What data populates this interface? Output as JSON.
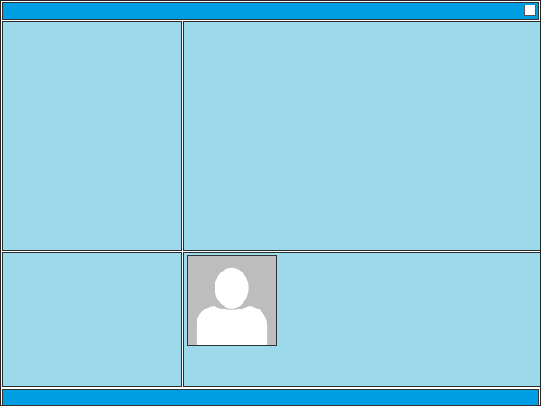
{
  "colors": {
    "titlebar": "#009fe3",
    "statusbar": "#009fe3",
    "panel": "#9cd9ea",
    "avatar_bg": "#bdbdbd",
    "avatar_fg": "#ffffff"
  },
  "titlebar": {
    "close_icon": "close-square-icon"
  },
  "panels": {
    "top_left": "empty-panel",
    "top_right": "empty-panel",
    "bottom_left": "empty-panel",
    "bottom_right": {
      "avatar_icon": "user-silhouette-icon"
    }
  }
}
